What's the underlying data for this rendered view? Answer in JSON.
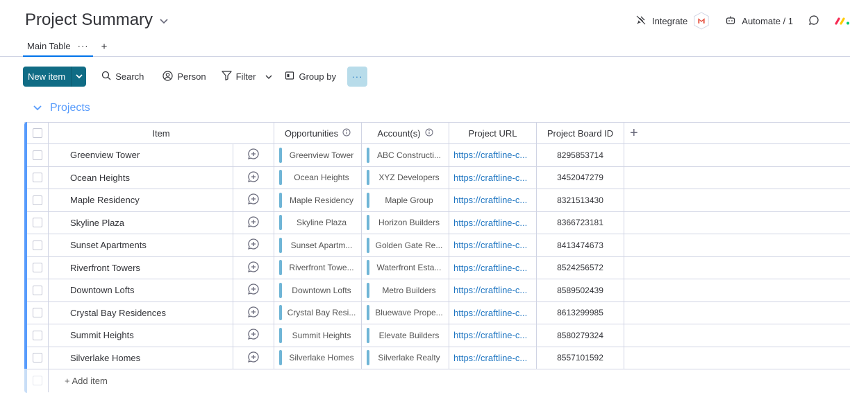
{
  "header": {
    "title": "Project Summary",
    "integrate_label": "Integrate",
    "automate_label": "Automate / 1"
  },
  "tabs": [
    {
      "label": "Main Table",
      "more": "···"
    }
  ],
  "add_tab": "+",
  "toolbar": {
    "new_item_label": "New item",
    "search_label": "Search",
    "person_label": "Person",
    "filter_label": "Filter",
    "group_by_label": "Group by",
    "more_label": "···"
  },
  "group": {
    "title": "Projects",
    "color": "#579bfc"
  },
  "columns": {
    "item": "Item",
    "opportunities": "Opportunities",
    "accounts": "Account(s)",
    "project_url": "Project URL",
    "board_id": "Project Board ID",
    "add": "+"
  },
  "rows": [
    {
      "item": "Greenview Tower",
      "opportunity": "Greenview Tower",
      "account": "ABC Constructi...",
      "url": "https://craftline-c...",
      "board_id": "8295853714"
    },
    {
      "item": "Ocean Heights",
      "opportunity": "Ocean Heights",
      "account": "XYZ Developers",
      "url": "https://craftline-c...",
      "board_id": "3452047279"
    },
    {
      "item": "Maple Residency",
      "opportunity": "Maple Residency",
      "account": "Maple Group",
      "url": "https://craftline-c...",
      "board_id": "8321513430"
    },
    {
      "item": "Skyline Plaza",
      "opportunity": "Skyline Plaza",
      "account": "Horizon Builders",
      "url": "https://craftline-c...",
      "board_id": "8366723181"
    },
    {
      "item": "Sunset Apartments",
      "opportunity": "Sunset Apartm...",
      "account": "Golden Gate Re...",
      "url": "https://craftline-c...",
      "board_id": "8413474673"
    },
    {
      "item": "Riverfront Towers",
      "opportunity": "Riverfront Towe...",
      "account": "Waterfront Esta...",
      "url": "https://craftline-c...",
      "board_id": "8524256572"
    },
    {
      "item": "Downtown Lofts",
      "opportunity": "Downtown Lofts",
      "account": "Metro Builders",
      "url": "https://craftline-c...",
      "board_id": "8589502439"
    },
    {
      "item": "Crystal Bay Residences",
      "opportunity": "Crystal Bay Resi...",
      "account": "Bluewave Prope...",
      "url": "https://craftline-c...",
      "board_id": "8613299985"
    },
    {
      "item": "Summit Heights",
      "opportunity": "Summit Heights",
      "account": "Elevate Builders",
      "url": "https://craftline-c...",
      "board_id": "8580279324"
    },
    {
      "item": "Silverlake Homes",
      "opportunity": "Silverlake Homes",
      "account": "Silverlake Realty",
      "url": "https://craftline-c...",
      "board_id": "8557101592"
    }
  ],
  "add_item_label": "+ Add item"
}
